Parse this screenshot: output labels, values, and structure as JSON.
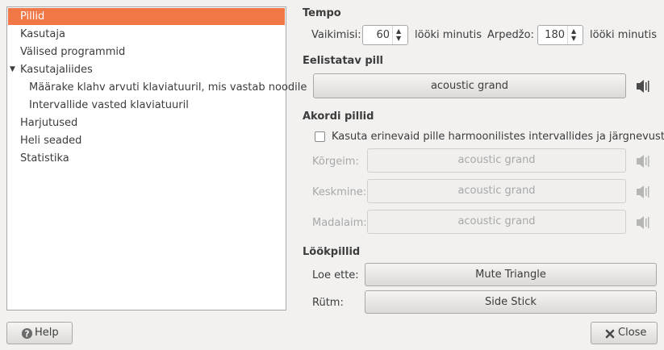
{
  "sidebar": {
    "items": [
      {
        "label": "Pillid"
      },
      {
        "label": "Kasutaja"
      },
      {
        "label": "Välised programmid"
      },
      {
        "label": "Kasutajaliides"
      },
      {
        "label": "Määrake klahv arvuti klaviatuuril, mis vastab noodile"
      },
      {
        "label": "Intervallide vasted klaviatuuril"
      },
      {
        "label": "Harjutused"
      },
      {
        "label": "Heli seaded"
      },
      {
        "label": "Statistika"
      }
    ],
    "expanded_arrow": "▼"
  },
  "tempo": {
    "title": "Tempo",
    "default_label": "Vaikimisi:",
    "default_value": "60",
    "default_unit": "lööki minutis",
    "arpeggio_label": "Arpedžo:",
    "arpeggio_value": "180",
    "arpeggio_unit": "lööki minutis"
  },
  "preferred_instrument": {
    "title": "Eelistatav pill",
    "value": "acoustic grand",
    "icon": "speaker-icon"
  },
  "chord_instruments": {
    "title": "Akordi pillid",
    "checkbox_label": "Kasuta erinevaid pille  harmoonilistes intervallides ja järgnevustes.",
    "checked": false,
    "highest_label": "Kõrgeim:",
    "highest_value": "acoustic grand",
    "middle_label": "Keskmine:",
    "middle_value": "acoustic grand",
    "lowest_label": "Madalaim:",
    "lowest_value": "acoustic grand"
  },
  "percussion": {
    "title": "Löökpillid",
    "count_in_label": "Loe ette:",
    "count_in_value": "Mute Triangle",
    "rhythm_label": "Rütm:",
    "rhythm_value": "Side Stick"
  },
  "footer": {
    "help_label": "Help",
    "close_label": "Close"
  }
}
